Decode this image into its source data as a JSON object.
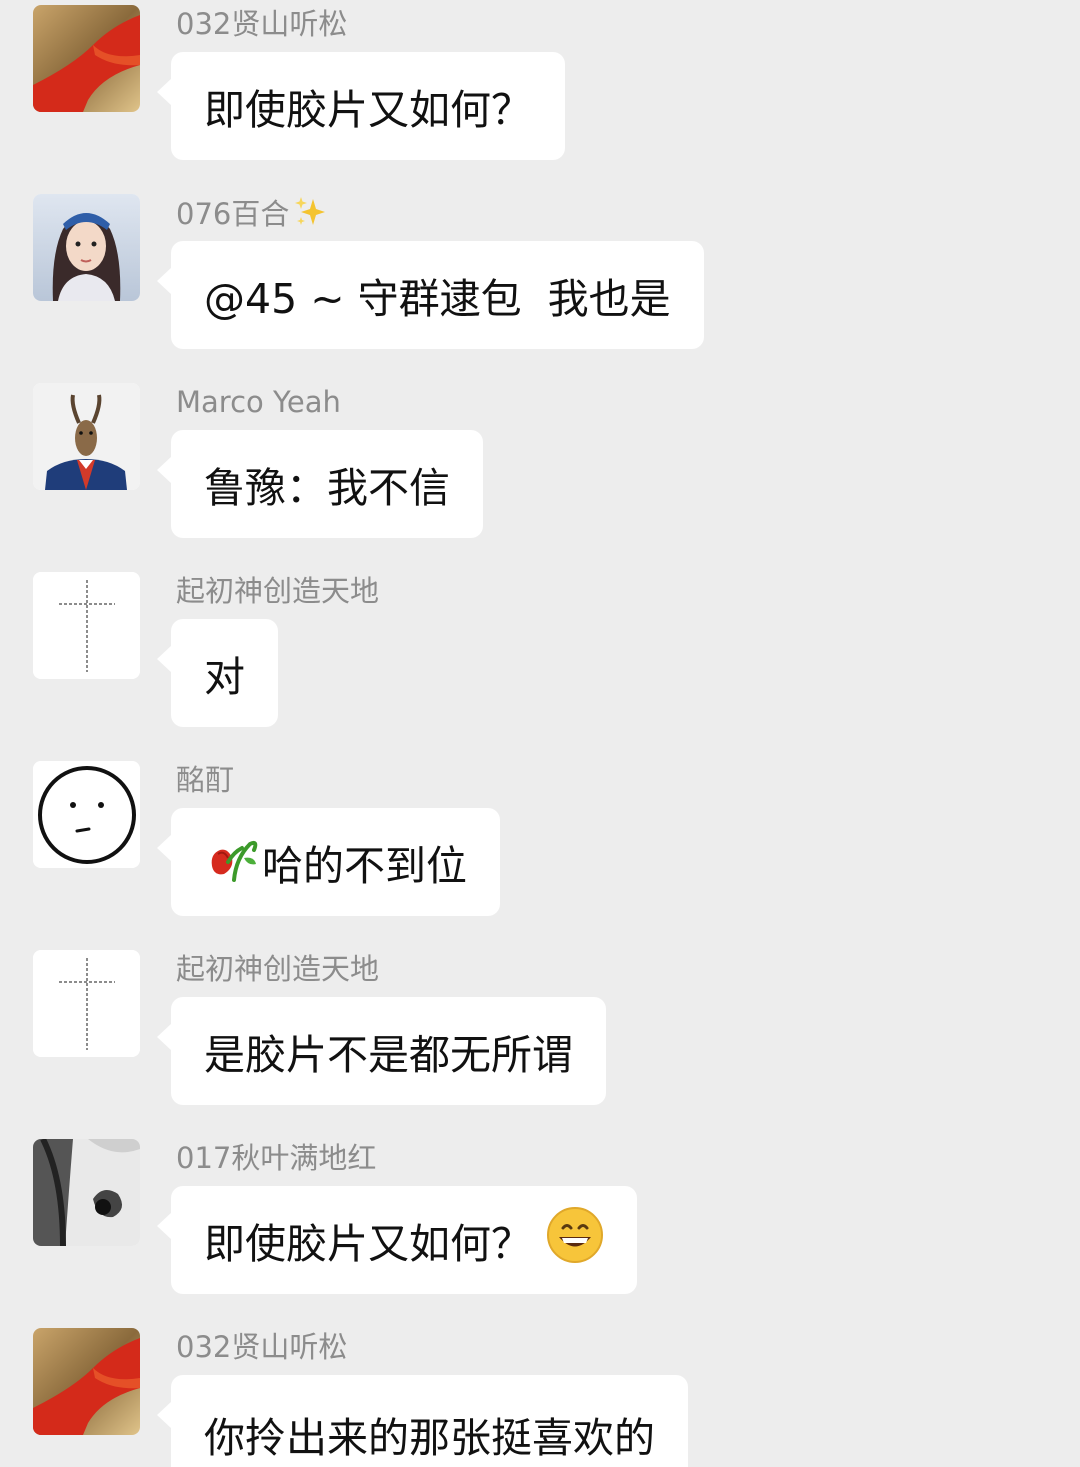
{
  "messages": [
    {
      "sender": "032贤山听松",
      "text": "即使胶片又如何？",
      "avatar": "red-gold-abstract-avatar"
    },
    {
      "sender": "076百合",
      "sender_icon": "sparkles-icon",
      "text": "@45 ~ 守群逮包  我也是",
      "avatar": "woman-portrait-avatar"
    },
    {
      "sender": "Marco Yeah",
      "text": "鲁豫：我不信",
      "avatar": "goat-in-suit-avatar"
    },
    {
      "sender": "起初神创造天地",
      "text": "对",
      "avatar": "cross-avatar"
    },
    {
      "sender": "酩酊",
      "text_prefix_icon": "wilted-rose-icon",
      "text": "哈的不到位",
      "avatar": "doodle-face-avatar"
    },
    {
      "sender": "起初神创造天地",
      "text": "是胶片不是都无所谓",
      "avatar": "cross-avatar"
    },
    {
      "sender": "017秋叶满地红",
      "text": "即使胶片又如何？",
      "text_suffix_icon": "grinning-face-emoji",
      "avatar": "ink-painting-avatar"
    },
    {
      "sender": "032贤山听松",
      "text": "你拎出来的那张挺喜欢的",
      "avatar": "red-gold-abstract-avatar"
    }
  ],
  "colors": {
    "background": "#ededed",
    "bubble": "#ffffff",
    "sender_name": "#8c8c8c",
    "text": "#111111"
  }
}
